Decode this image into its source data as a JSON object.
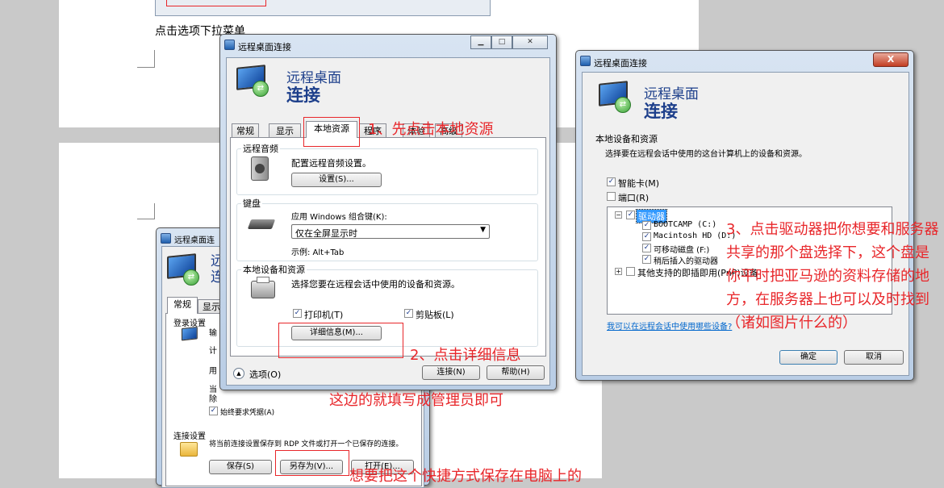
{
  "doc": {
    "caption_dropdown": "点击选项下拉菜单"
  },
  "main_dialog": {
    "title": "远程桌面连接",
    "header_line1": "远程桌面",
    "header_line2": "连接",
    "tabs": [
      "常规",
      "显示",
      "本地资源",
      "程序",
      "体验",
      "高级"
    ],
    "audio": {
      "group": "远程音频",
      "desc": "配置远程音频设置。",
      "button": "设置(S)..."
    },
    "keyboard": {
      "group": "键盘",
      "desc": "应用 Windows 组合键(K):",
      "select_value": "仅在全屏显示时",
      "example": "示例: Alt+Tab"
    },
    "local": {
      "group": "本地设备和资源",
      "desc": "选择您要在远程会话中使用的设备和资源。",
      "printer": "打印机(T)",
      "clipboard": "剪贴板(L)",
      "details_button": "详细信息(M)..."
    },
    "options": "选项(O)",
    "connect": "连接(N)",
    "help": "帮助(H)"
  },
  "back_dialog": {
    "title": "远程桌面连",
    "tabs": [
      "常规",
      "显示"
    ],
    "login_group": "登录设置",
    "frag1": "输",
    "frag2": "计",
    "frag3": "用",
    "frag4": "当",
    "frag5": "除",
    "always_ask": "始终要求凭据(A)",
    "conn_group": "连接设置",
    "conn_desc": "将当前连接设置保存到 RDP 文件或打开一个已保存的连接。",
    "save": "保存(S)",
    "save_as": "另存为(V)...",
    "open": "打开(E)..."
  },
  "right_dialog": {
    "title": "远程桌面连接",
    "close": "X",
    "header_line1": "远程桌面",
    "header_line2": "连接",
    "group": "本地设备和资源",
    "desc": "选择要在远程会话中使用的这台计算机上的设备和资源。",
    "smartcard": "智能卡(M)",
    "ports": "端口(R)",
    "drives": "驱动器",
    "drive_items": [
      "BOOTCAMP (C:)",
      "Macintosh HD (D:)",
      "可移动磁盘 (F:)",
      "稍后插入的驱动器"
    ],
    "pnp": "其他支持的即插即用(PnP)设备",
    "link": "我可以在远程会话中使用哪些设备?",
    "ok": "确定",
    "cancel": "取消"
  },
  "annotations": {
    "step1": "1、先点击本地资源",
    "step2": "2、点击详细信息",
    "step3": "3、点击驱动器把你想要和服务器共享的那个盘选择下，这个盘是你平时把亚马逊的资料存储的地方，在服务器上也可以及时找到（诸如图片什么的）",
    "note_admin": "这边的就填写成管理员即可",
    "note_save": "想要把这个快捷方式保存在电脑上的"
  }
}
